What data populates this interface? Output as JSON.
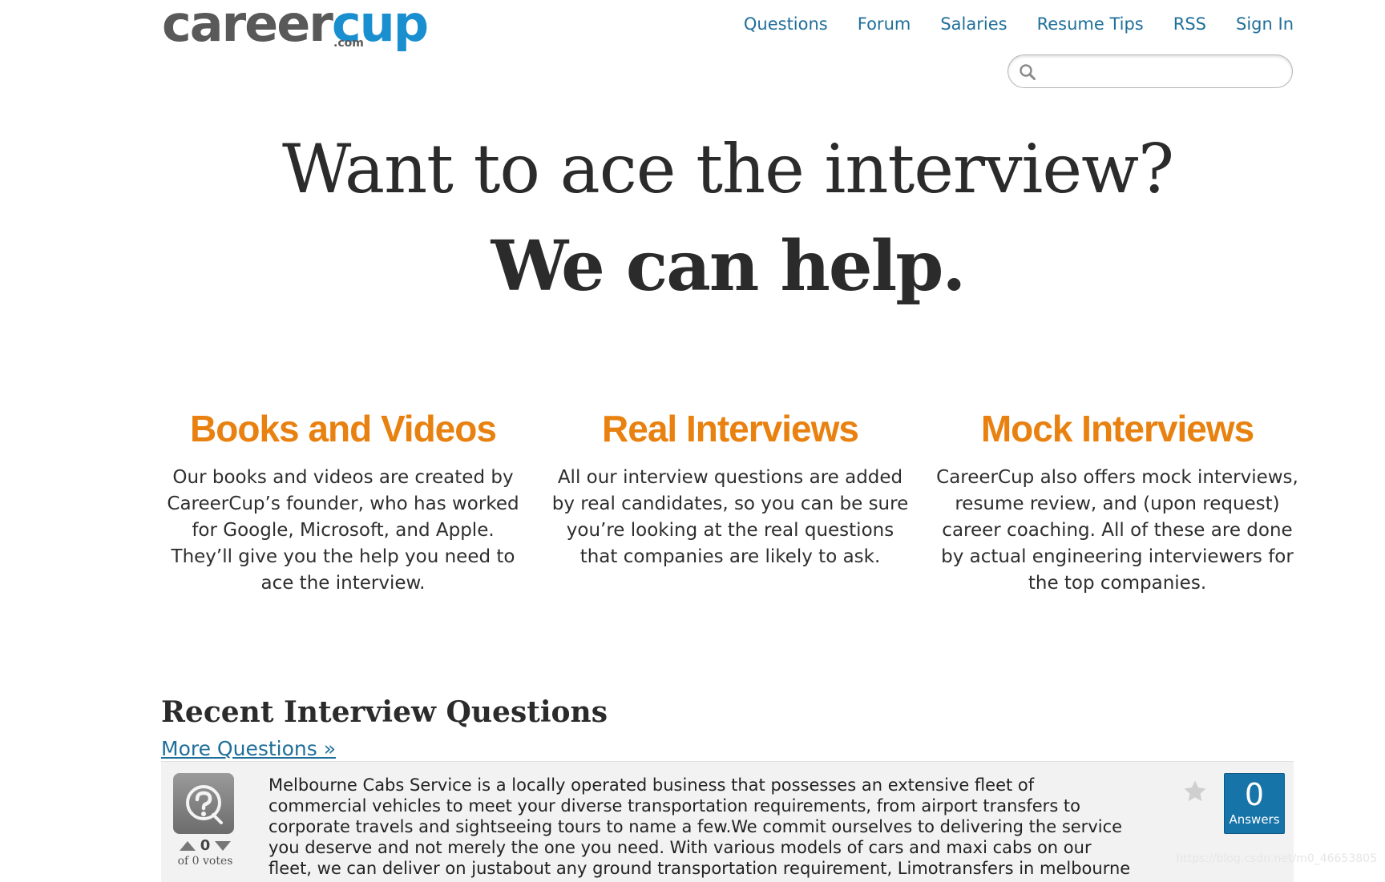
{
  "header": {
    "logo": {
      "main": "career",
      "accent": "cup",
      "suffix": ".com"
    },
    "nav": [
      {
        "label": "Questions"
      },
      {
        "label": "Forum"
      },
      {
        "label": "Salaries"
      },
      {
        "label": "Resume Tips"
      },
      {
        "label": "RSS"
      },
      {
        "label": "Sign In"
      }
    ],
    "search": {
      "value": "",
      "placeholder": ""
    }
  },
  "hero": {
    "line1": "Want to ace the interview?",
    "line2": "We can help."
  },
  "features": [
    {
      "title": "Books and Videos",
      "text": "Our books and videos are created by CareerCup’s founder, who has worked for Google, Microsoft, and Apple. They’ll give you the help you need to ace the interview."
    },
    {
      "title": "Real Interviews",
      "text": "All our interview questions are added by real candidates, so you can be sure you’re looking at the real questions that companies are likely to ask."
    },
    {
      "title": "Mock Interviews",
      "text": "CareerCup also offers mock interviews, resume review, and (upon request) career coaching. All of these are done by actual engineering interviewers for the top companies."
    }
  ],
  "recent": {
    "title": "Recent Interview Questions",
    "more_link": "More Questions »",
    "question": {
      "votes": "0",
      "votes_meta": "of 0 votes",
      "text": "Melbourne Cabs Service is a locally operated business that possesses an extensive fleet of commercial vehicles to meet your diverse transportation requirements, from airport transfers to corporate travels and sightseeing tours to name a few.We commit ourselves to delivering the service you deserve and not merely the one you need. With various models of cars and maxi cabs on our fleet, we can deliver on justabout any ground transportation requirement, Limotransfers in melbourne",
      "answers_count": "0",
      "answers_label": "Answers"
    }
  },
  "watermark": "https://blog.csdn.net/m0_46653805",
  "colors": {
    "link": "#1f6f9a",
    "accent_orange": "#e8810f",
    "logo_blue": "#1a8fd0",
    "answers_blue": "#1674a8"
  }
}
